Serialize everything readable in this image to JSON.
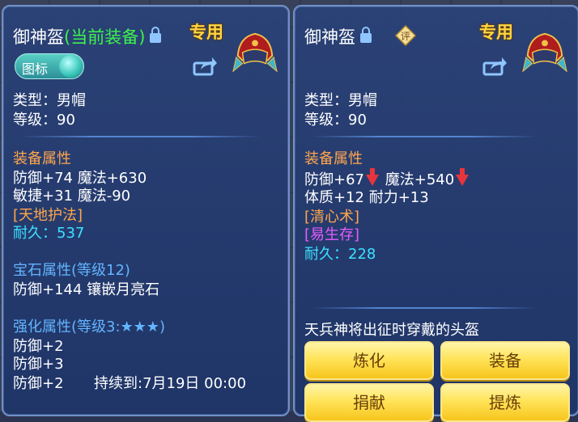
{
  "left": {
    "item_name": "御神盔",
    "equipped_tag": "(当前装备)",
    "special_label": "专用",
    "toggle_label": "图标",
    "type_line": "类型：男帽",
    "level_line": "等级：90",
    "attr_header": "装备属性",
    "attr_line1": "防御+74 魔法+630",
    "attr_line2": "敏捷+31 魔法-90",
    "skill": "[天地护法]",
    "durability": "耐久：537",
    "gem_header_a": "宝石属性",
    "gem_header_b": "(等级12)",
    "gem_line": "防御+144 镶嵌月亮石",
    "enhance_header_a": "强化属性",
    "enhance_header_b": "(等级3:★★★)",
    "enhance_line1": "防御+2",
    "enhance_line2": "防御+3",
    "enhance_line3": "防御+2",
    "enhance_duration": "持续到:7月19日 00:00"
  },
  "right": {
    "item_name": "御神盔",
    "special_label": "专用",
    "type_line": "类型：男帽",
    "level_line": "等级：90",
    "attr_header": "装备属性",
    "attr_a1": "防御+67",
    "attr_a2": "魔法+540",
    "attr_line2": "体质+12 耐力+13",
    "skill1": "[清心术]",
    "skill2": "[易生存]",
    "durability": "耐久：228",
    "description": "天兵神将出征时穿戴的头盔",
    "buttons": {
      "refine": "炼化",
      "equip": "装备",
      "donate": "捐献",
      "extract": "提炼"
    }
  },
  "icons": [
    "lock-icon",
    "helmet-icon",
    "share-icon",
    "evaluate-icon",
    "arrow-down-icon"
  ],
  "colors": {
    "green": "#3df24f",
    "gold": "#ffd640",
    "orange": "#ffa64c",
    "cyan": "#3de0ff",
    "magenta": "#e65cff",
    "down": "#e8343c"
  }
}
